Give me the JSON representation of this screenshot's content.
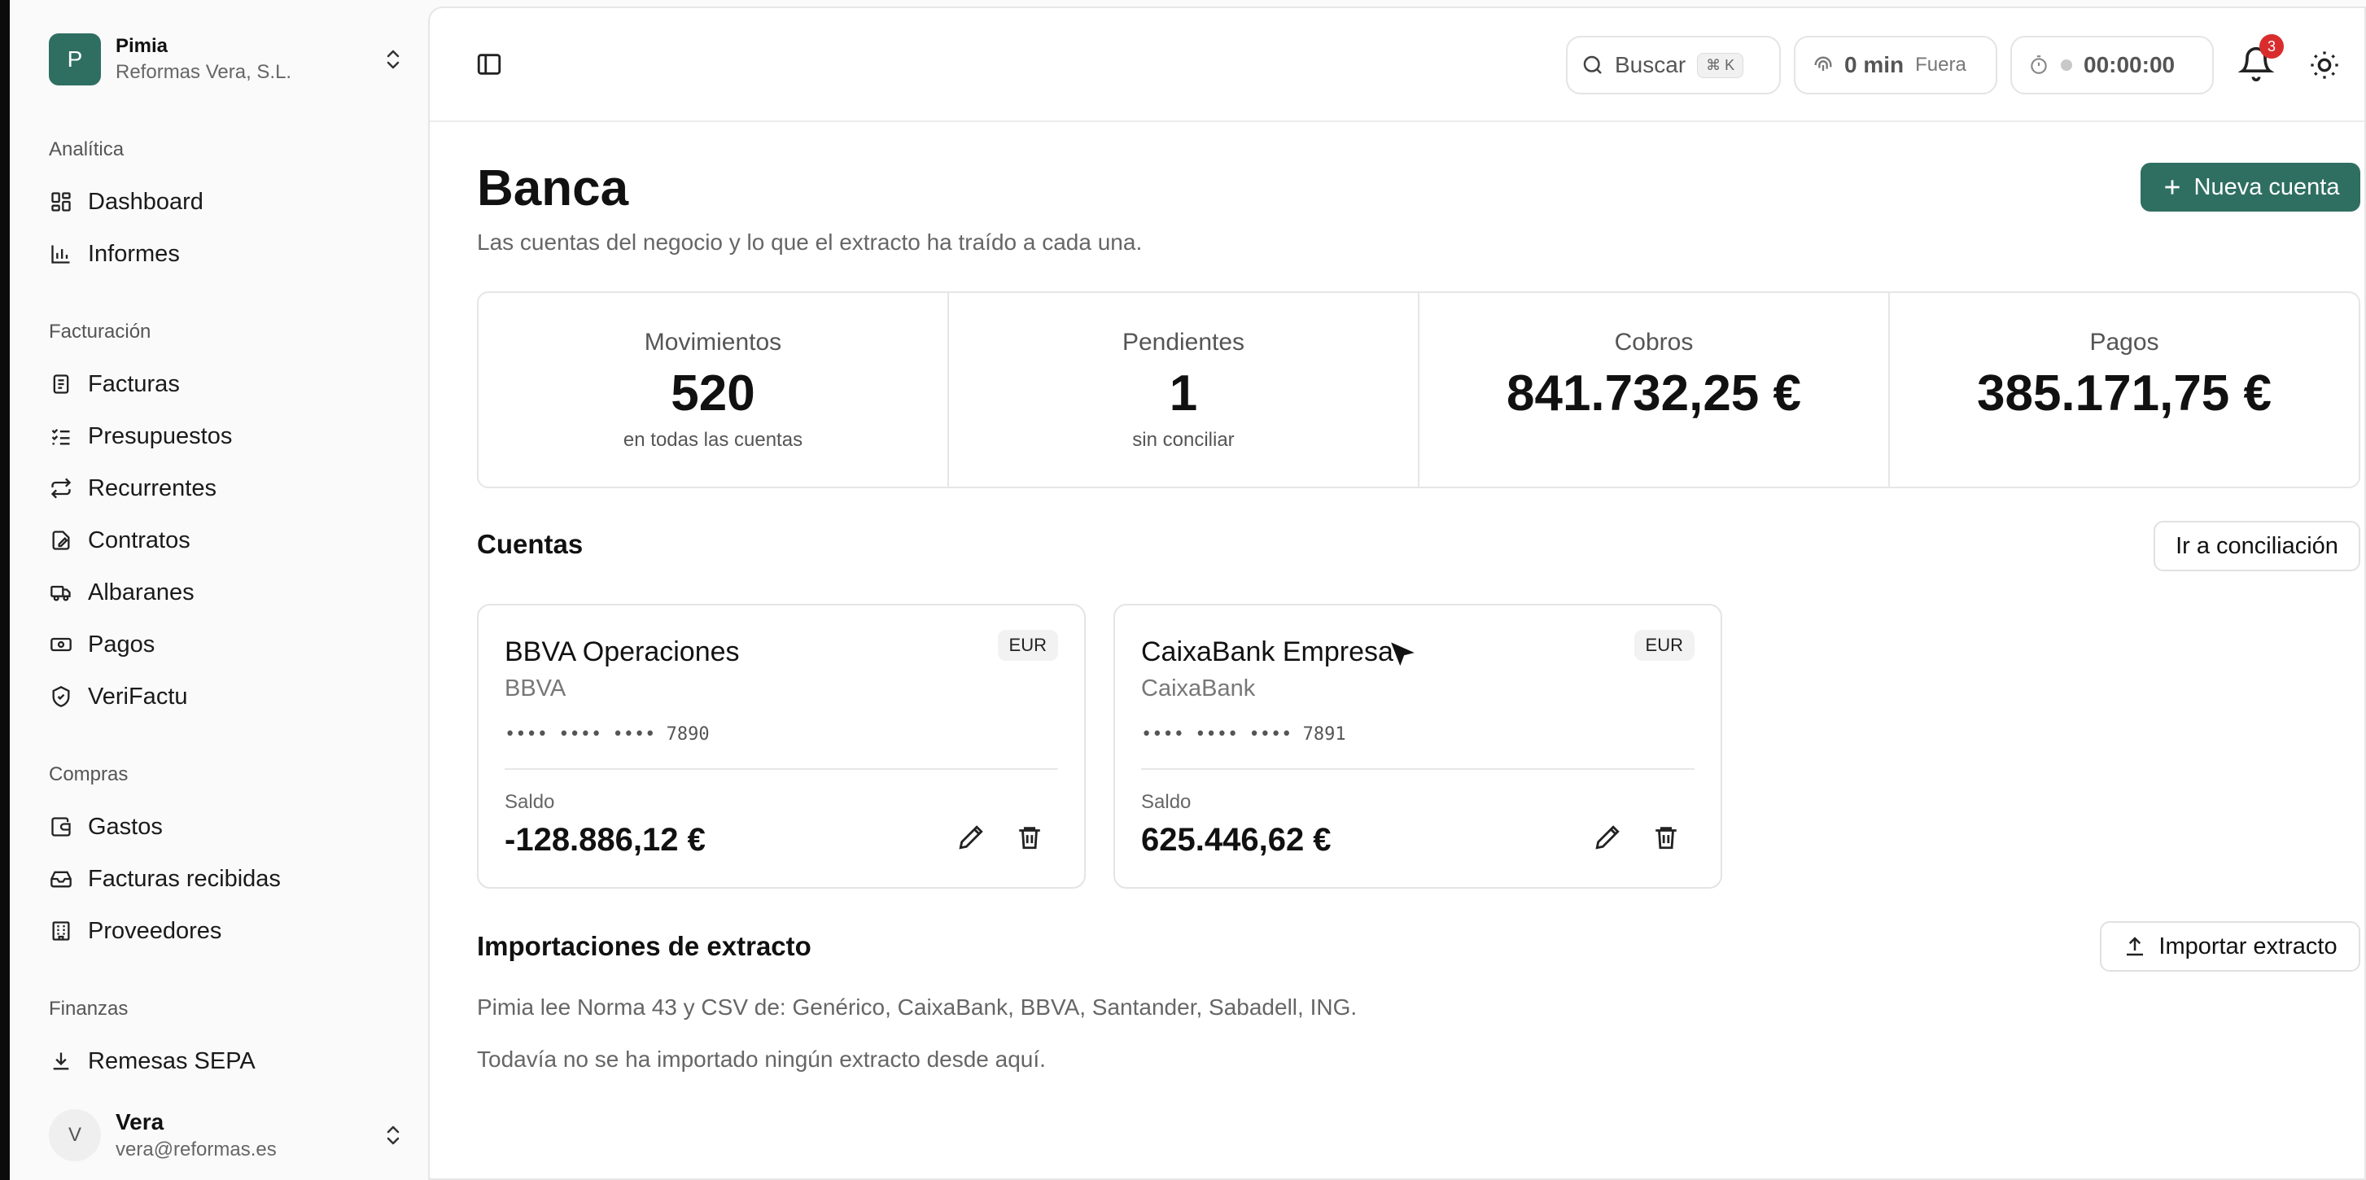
{
  "org": {
    "initial": "P",
    "name": "Pimia",
    "company": "Reformas Vera, S.L."
  },
  "sidebar": {
    "sections": [
      {
        "title": "Analítica",
        "items": [
          {
            "label": "Dashboard",
            "icon": "dashboard-icon"
          },
          {
            "label": "Informes",
            "icon": "chart-icon"
          }
        ]
      },
      {
        "title": "Facturación",
        "items": [
          {
            "label": "Facturas",
            "icon": "invoice-icon"
          },
          {
            "label": "Presupuestos",
            "icon": "checklist-icon"
          },
          {
            "label": "Recurrentes",
            "icon": "repeat-icon"
          },
          {
            "label": "Contratos",
            "icon": "contract-icon"
          },
          {
            "label": "Albaranes",
            "icon": "truck-icon"
          },
          {
            "label": "Pagos",
            "icon": "banknote-icon"
          },
          {
            "label": "VeriFactu",
            "icon": "shield-check-icon"
          }
        ]
      },
      {
        "title": "Compras",
        "items": [
          {
            "label": "Gastos",
            "icon": "wallet-icon"
          },
          {
            "label": "Facturas recibidas",
            "icon": "inbox-icon"
          },
          {
            "label": "Proveedores",
            "icon": "building-icon"
          }
        ]
      },
      {
        "title": "Finanzas",
        "items": [
          {
            "label": "Remesas SEPA",
            "icon": "download-icon"
          }
        ]
      }
    ]
  },
  "user": {
    "initial": "V",
    "name": "Vera",
    "email": "vera@reformas.es"
  },
  "topbar": {
    "search_label": "Buscar",
    "search_kbd": "⌘ K",
    "time_value": "0 min",
    "time_status": "Fuera",
    "timer": "00:00:00",
    "notifications": "3"
  },
  "page": {
    "title": "Banca",
    "subtitle": "Las cuentas del negocio y lo que el extracto ha traído a cada una.",
    "new_account": "Nueva cuenta"
  },
  "stats": [
    {
      "label": "Movimientos",
      "value": "520",
      "note": "en todas las cuentas"
    },
    {
      "label": "Pendientes",
      "value": "1",
      "note": "sin conciliar"
    },
    {
      "label": "Cobros",
      "value": "841.732,25 €",
      "note": ""
    },
    {
      "label": "Pagos",
      "value": "385.171,75 €",
      "note": ""
    }
  ],
  "accounts_section": {
    "title": "Cuentas",
    "reconcile_button": "Ir a conciliación"
  },
  "accounts": [
    {
      "name": "BBVA Operaciones",
      "bank": "BBVA",
      "currency": "EUR",
      "number": "•••• •••• •••• 7890",
      "balance_label": "Saldo",
      "balance": "-128.886,12 €"
    },
    {
      "name": "CaixaBank Empresa",
      "bank": "CaixaBank",
      "currency": "EUR",
      "number": "•••• •••• •••• 7891",
      "balance_label": "Saldo",
      "balance": "625.446,62 €"
    }
  ],
  "imports": {
    "title": "Importaciones de extracto",
    "import_button": "Importar extracto",
    "info": "Pimia lee Norma 43 y CSV de: Genérico, CaixaBank, BBVA, Santander, Sabadell, ING.",
    "empty": "Todavía no se ha importado ningún extracto desde aquí."
  },
  "colors": {
    "accent": "#2f6f62",
    "badge": "#d92d2d"
  }
}
